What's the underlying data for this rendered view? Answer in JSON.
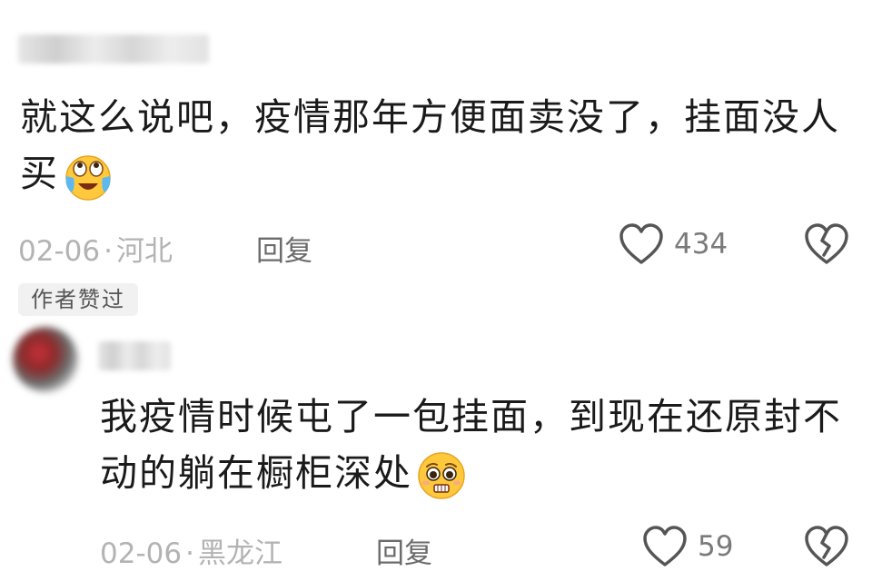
{
  "comments": [
    {
      "text": "就这么说吧，疫情那年方便面卖没了，挂面没人买",
      "emoji": "crying-laughing-emoji",
      "date": "02-06",
      "separator": "·",
      "location": "河北",
      "reply_label": "回复",
      "likes": "434",
      "badge": "作者赞过"
    },
    {
      "text": "我疫情时候屯了一包挂面，到现在还原封不动的躺在橱柜深处",
      "emoji": "pleading-emoji",
      "date": "02-06",
      "separator": "·",
      "location": "黑龙江",
      "reply_label": "回复",
      "likes": "59"
    }
  ],
  "icons": {
    "like": "heart-outline-icon",
    "dislike": "broken-heart-icon"
  },
  "colors": {
    "text": "#1a1a1a",
    "meta": "#b3b3b3",
    "icon": "#555555"
  }
}
